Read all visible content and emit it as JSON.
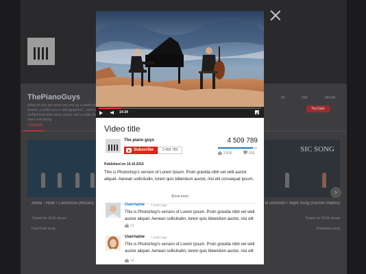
{
  "background": {
    "channel_name": "ThePianoGuys",
    "channel_desc": "What do you get when you mix up a world-class pianist, a cellist and a videographer? ...and a crafted beat with some career and a collar that does everything",
    "tab_uploads": "Uploads",
    "video_left_title": "Adele - Hello / Lacrimosa (Mozart)",
    "video_left_sub": "Tickets for 2016 shows",
    "video_left_sub2": "Download song:",
    "video_right_title": "Story of My Life - One Direction / Night Song (Rachel Platten)",
    "video_right_sub": "Tickets for 2016 shows",
    "video_right_sub2": "Download song:",
    "right_thumb_overlay": "SIC SONG",
    "yt_button": "YouTube",
    "stats": [
      "80",
      "69K",
      "664.8K"
    ]
  },
  "video": {
    "time": "14:34",
    "progress": 0.14
  },
  "details": {
    "title": "Video title",
    "channel": "The piano guys",
    "subscribe_label": "Subscribe",
    "subscribers": "3 456 789",
    "views": "4 509 789",
    "likes": "2 810",
    "dislikes": "510",
    "like_ratio": 0.9,
    "published": "Published on 14.10.2015",
    "description": "This is Photoshop's version  of Lorem Ipsum. Proin gravida nibh vel velit auctor aliquet. Aenean sollicitudin, lorem quis bibendum auctor, nisi elit consequat ipsum, nec sagittis sem nibh id elit.",
    "show_more": "Show more"
  },
  "comments": [
    {
      "username": "Username",
      "time": "7 years ago",
      "text": "This is Photoshop's version  of Lorem Ipsum. Proin gravida nibh vel velit auctor aliquet. Aenean sollicitudin, lorem quis bibendum auctor, nisi elit consequat ipsum.",
      "likes": "13"
    },
    {
      "username": "Username",
      "time": "7 years ago",
      "text": "This is Photoshop's version  of Lorem Ipsum. Proin gravida nibh vel velit auctor aliquet. Aenean sollicitudin, lorem quis bibendum auctor, nisi elit consequat ipsum.",
      "likes": "14"
    }
  ],
  "colors": {
    "subscribe": "#e62117",
    "link": "#167ac6",
    "overlay": "#1b1b1e"
  }
}
